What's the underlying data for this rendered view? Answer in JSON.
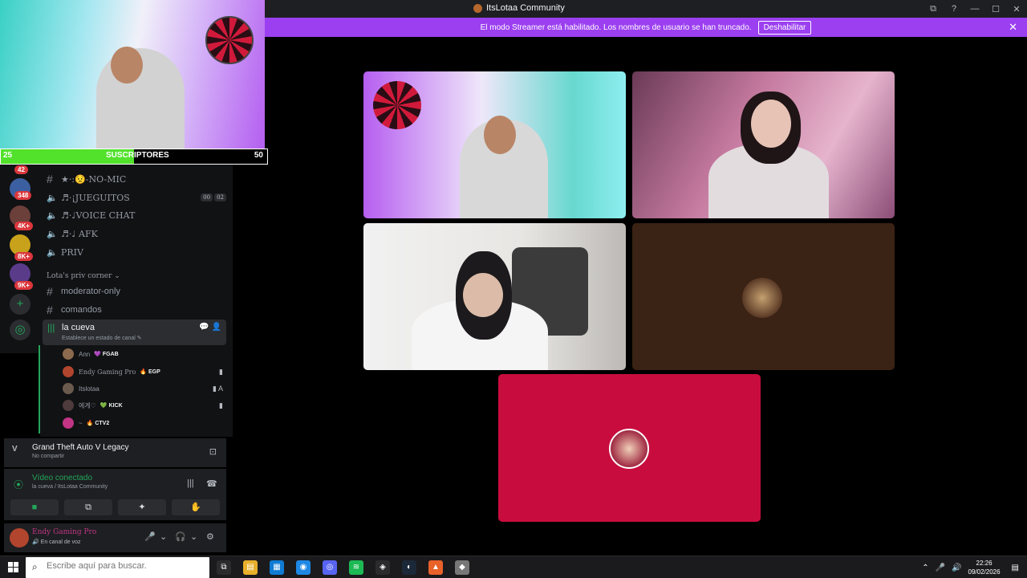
{
  "window": {
    "title": "ItsLotaa Community",
    "buttons": [
      "⧉",
      "?",
      "—",
      "☐",
      "✕"
    ]
  },
  "banner": {
    "text": "El modo Streamer está habilitado. Los nombres de usuario se han truncado.",
    "button": "Deshabilitar",
    "close": "✕"
  },
  "subs": {
    "left": "25",
    "label": "SUSCRIPTORES",
    "right": "50",
    "progress": 0.5
  },
  "servers": {
    "badges": [
      "42",
      "348",
      "4K+",
      "8K+",
      "9K+"
    ],
    "add_icon": "+",
    "discover_icon": "◎"
  },
  "channels": [
    {
      "type": "text",
      "name": "★·:😟-NO-MIC"
    },
    {
      "type": "voice",
      "name": "♬·¡JUEGUITOS",
      "counts": [
        "00",
        "02"
      ]
    },
    {
      "type": "voice",
      "name": "♬·♩VOICE CHAT"
    },
    {
      "type": "voice",
      "name": "♬·♩ AFK"
    },
    {
      "type": "voice",
      "name": "PRIV"
    }
  ],
  "category": "Lota's priv corner ⌄",
  "category_channels": [
    {
      "name": "moderator-only"
    },
    {
      "name": "comandos"
    }
  ],
  "active_channel": {
    "name": "la cueva",
    "status": "Establece un estado de canal ✎",
    "right_icons": "💬 👤"
  },
  "members": [
    {
      "name": "Ann",
      "tag": "💜 FGAB",
      "color": "#8b6a4d",
      "icons": ""
    },
    {
      "name": "Endy Gaming Pro",
      "tag": "🔥 EGP",
      "color": "#b2452d",
      "icons": "▮"
    },
    {
      "name": "Itslotaa",
      "tag": "",
      "color": "#6a5a4e",
      "icons": "▮ A"
    },
    {
      "name": "에게♡",
      "tag": "💚 KICK",
      "color": "#4e3b3b",
      "icons": "▮"
    },
    {
      "name": "~",
      "tag": "🔥 CTV2",
      "color": "#c13584",
      "icons": ""
    }
  ],
  "game": {
    "title": "Grand Theft Auto V Legacy",
    "subtitle": "No compartir",
    "icon": "V",
    "action_icon": "⊡"
  },
  "voice": {
    "title": "Vídeo conectado",
    "subtitle": "la cueva / ItsLotaa Community",
    "signal_icon": "⦿",
    "noise_icon": "|||",
    "disconnect_icon": "☎",
    "buttons": [
      "■",
      "⧉",
      "✦",
      "✋"
    ]
  },
  "user": {
    "name": "Endy Gaming Pro",
    "status": "🔊 En canal de voz",
    "controls": [
      "🎤",
      "⌄",
      "🎧",
      "⌄",
      "⚙"
    ]
  },
  "taskbar": {
    "search_placeholder": "Escribe aquí para buscar.",
    "time": "22:26",
    "date": "09/02/2026",
    "tray": [
      "⌃",
      "🎤",
      "🔊"
    ],
    "notif": "▤",
    "apps": [
      {
        "icon": "⧉",
        "color": "#2b2b2d"
      },
      {
        "icon": "▤",
        "color": "#e8b02a"
      },
      {
        "icon": "▦",
        "color": "#0f7bd4"
      },
      {
        "icon": "◉",
        "color": "#1e88e5"
      },
      {
        "icon": "◎",
        "color": "#5865f2"
      },
      {
        "icon": "≋",
        "color": "#1db954"
      },
      {
        "icon": "◈",
        "color": "#2b2b2d"
      },
      {
        "icon": "◐",
        "color": "#1b2838"
      },
      {
        "icon": "▲",
        "color": "#e8622a"
      },
      {
        "icon": "◆",
        "color": "#777"
      }
    ]
  }
}
